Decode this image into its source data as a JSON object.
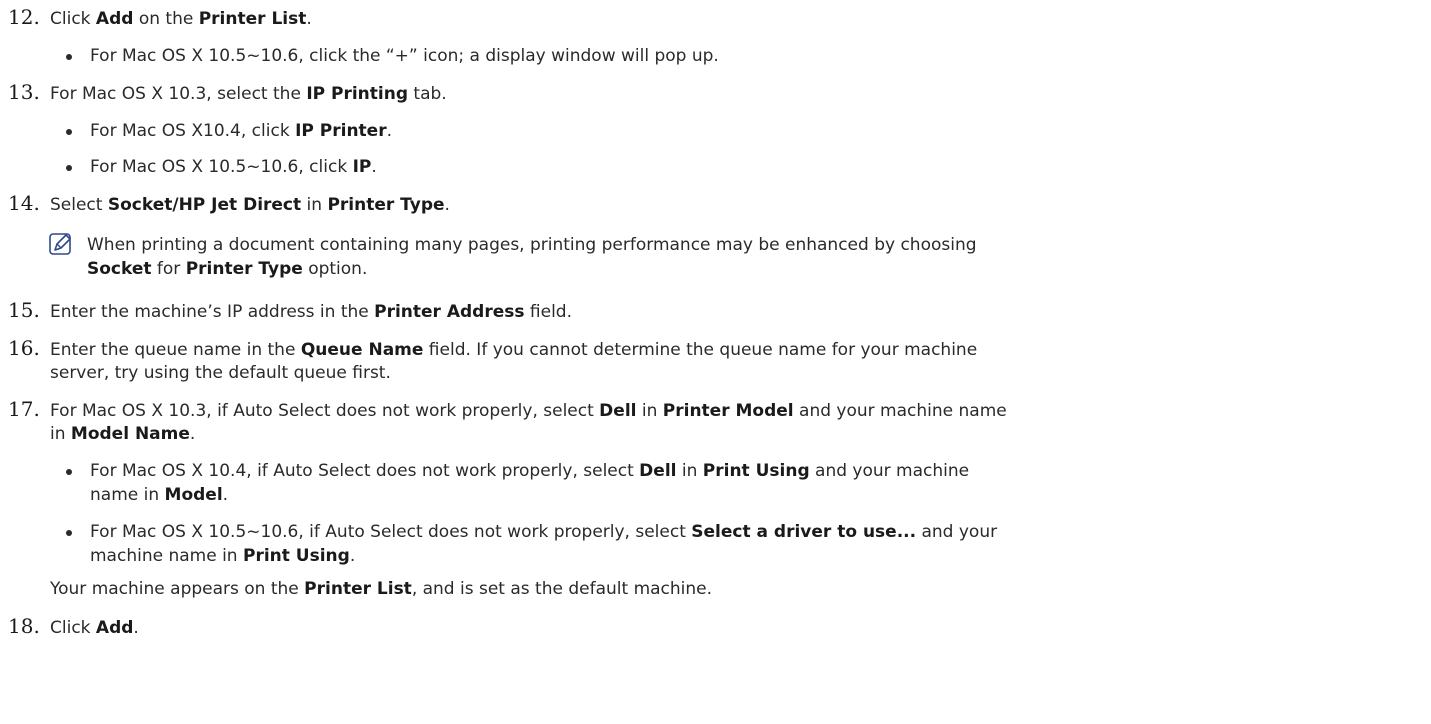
{
  "steps": {
    "s12": {
      "number": "12.",
      "a": "Click ",
      "b1": "Add",
      "c": " on the ",
      "b2": "Printer List",
      "d": ".",
      "bullet1": "For Mac OS X 10.5~10.6, click the “+” icon; a display window will pop up."
    },
    "s13": {
      "number": "13.",
      "a": "For Mac OS X 10.3, select the ",
      "b1": "IP Printing",
      "c": " tab.",
      "bullet1_a": "For Mac OS X10.4, click ",
      "bullet1_b": "IP Printer",
      "bullet1_c": ".",
      "bullet2_a": "For Mac OS X 10.5~10.6, click ",
      "bullet2_b": "IP",
      "bullet2_c": "."
    },
    "s14": {
      "number": "14.",
      "a": "Select ",
      "b1": "Socket/HP Jet Direct",
      "c": " in ",
      "b2": "Printer Type",
      "d": ".",
      "note_line1": "When printing a document containing many pages, printing performance may be enhanced by choosing",
      "note_b1": "Socket",
      "note_c": " for ",
      "note_b2": "Printer Type",
      "note_d": " option."
    },
    "s15": {
      "number": "15.",
      "a": "Enter the machine’s IP address in the ",
      "b1": "Printer Address",
      "c": " field."
    },
    "s16": {
      "number": "16.",
      "a": "Enter the queue name in the ",
      "b1": "Queue Name",
      "c": " field. If you cannot determine the queue name for your machine",
      "line2": "server, try using the default queue first."
    },
    "s17": {
      "number": "17.",
      "a": "For Mac OS X 10.3, if Auto Select does not work properly, select ",
      "b1": "Dell",
      "c": " in ",
      "b2": "Printer Model",
      "d": " and your machine name",
      "line2_a": "in ",
      "line2_b": "Model Name",
      "line2_c": ".",
      "bullet1_a": "For Mac OS X 10.4, if Auto Select does not work properly, select ",
      "bullet1_b": "Dell",
      "bullet1_c": " in ",
      "bullet1_d": "Print Using",
      "bullet1_e": " and your machine",
      "bullet1_line2_a": "name in ",
      "bullet1_line2_b": "Model",
      "bullet1_line2_c": ".",
      "bullet2_a": "For Mac OS X 10.5~10.6, if Auto Select does not work properly, select ",
      "bullet2_b": "Select a driver to use...",
      "bullet2_c": " and your",
      "bullet2_line2_a": "machine name in ",
      "bullet2_line2_b": "Print Using",
      "bullet2_line2_c": ".",
      "trailing_a": "Your machine appears on the ",
      "trailing_b": "Printer List",
      "trailing_c": ", and is set as the default machine."
    },
    "s18": {
      "number": "18.",
      "a": "Click ",
      "b1": "Add",
      "c": "."
    }
  },
  "icons": {
    "note": "note-pencil-icon"
  }
}
